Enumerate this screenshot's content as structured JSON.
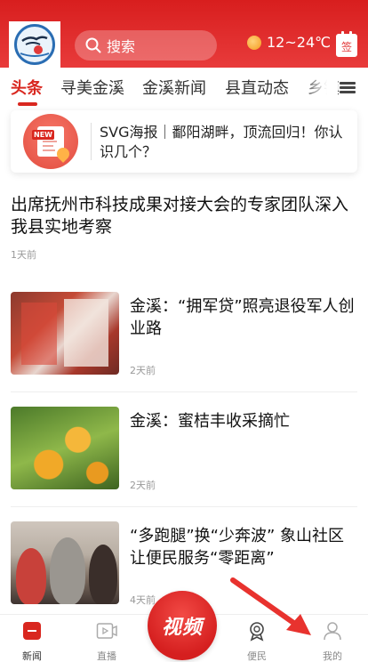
{
  "header": {
    "search_placeholder": "搜索",
    "weather_temp": "12~24℃",
    "signin_label": "签"
  },
  "tabs": [
    {
      "label": "头条",
      "active": true
    },
    {
      "label": "寻美金溪",
      "active": false
    },
    {
      "label": "金溪新闻",
      "active": false
    },
    {
      "label": "县直动态",
      "active": false
    },
    {
      "label": "乡镇",
      "active": false
    }
  ],
  "promo": {
    "badge": "NEW",
    "text": "SVG海报｜鄱阳湖畔，顶流回归！你认识几个？"
  },
  "feature": {
    "title": "出席抚州市科技成果对接大会的专家团队深入我县实地考察",
    "time": "1天前"
  },
  "news_items": [
    {
      "title": "金溪：“拥军贷”照亮退役军人创业路",
      "time": "2天前",
      "thumb": "exhibition-board-photo"
    },
    {
      "title": "金溪：蜜桔丰收采摘忙",
      "time": "2天前",
      "thumb": "tangerine-tree-photo"
    },
    {
      "title": "“多跑腿”换“少奔波” 象山社区让便民服务“零距离”",
      "time": "4天前",
      "thumb": "community-service-photo"
    }
  ],
  "bottom_nav": {
    "items": [
      {
        "label": "新闻",
        "icon": "news-icon",
        "active": true
      },
      {
        "label": "直播",
        "icon": "live-icon",
        "active": false
      },
      {
        "label": "便民",
        "icon": "service-icon",
        "active": false
      },
      {
        "label": "我的",
        "icon": "profile-icon",
        "active": false
      }
    ],
    "center_label": "视频"
  },
  "colors": {
    "brand_red": "#d9271f",
    "header_red": "#e0302a",
    "muted_text": "#999999"
  }
}
